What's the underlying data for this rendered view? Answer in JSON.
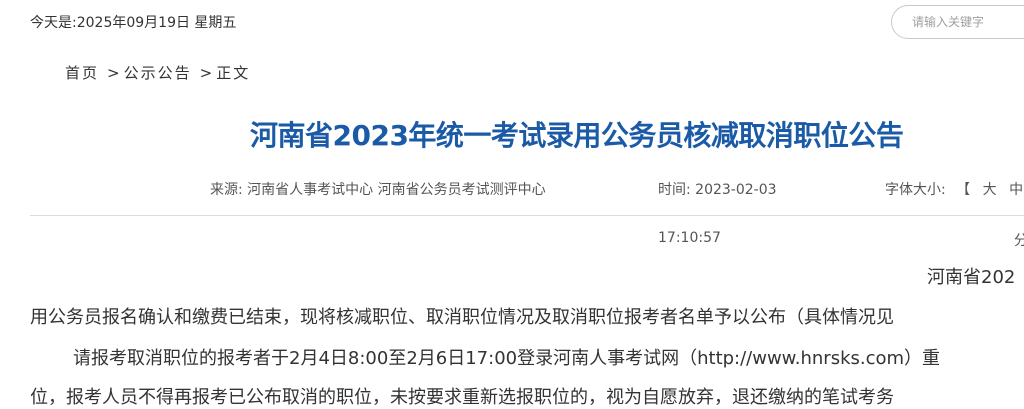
{
  "header": {
    "date_text": "今天是:2025年09月19日 星期五",
    "search_placeholder": "请输入关键字"
  },
  "breadcrumb": {
    "home": "首页",
    "separator": ">",
    "section": "公示公告",
    "current": "正文"
  },
  "article": {
    "title": "河南省2023年统一考试录用公务员核减取消职位公告",
    "source_label": "来源:",
    "source_value": "河南省人事考试中心 河南省公务员考试测评中心",
    "time_label": "时间:",
    "time_date": "2023-02-03",
    "time_clock": "17:10:57",
    "font_size_label": "字体大小:",
    "font_size_options": "【 大 中",
    "share_fragment": "分",
    "paragraph_intro_fragment": "河南省202",
    "paragraph_1": "用公务员报名确认和缴费已结束，现将核减职位、取消职位情况及取消职位报考者名单予以公布（具体情况见",
    "paragraph_2": "请报考取消职位的报考者于2月4日8:00至2月6日17:00登录河南人事考试网（http://www.hnrsks.com）重",
    "paragraph_3": "位，报考人员不得再报考已公布取消的职位，未按要求重新选报职位的，视为自愿放弃，退还缴纳的笔试考务"
  },
  "colors": {
    "title": "#1a5aa6",
    "text": "#333333",
    "divider": "#dcdcdc"
  }
}
